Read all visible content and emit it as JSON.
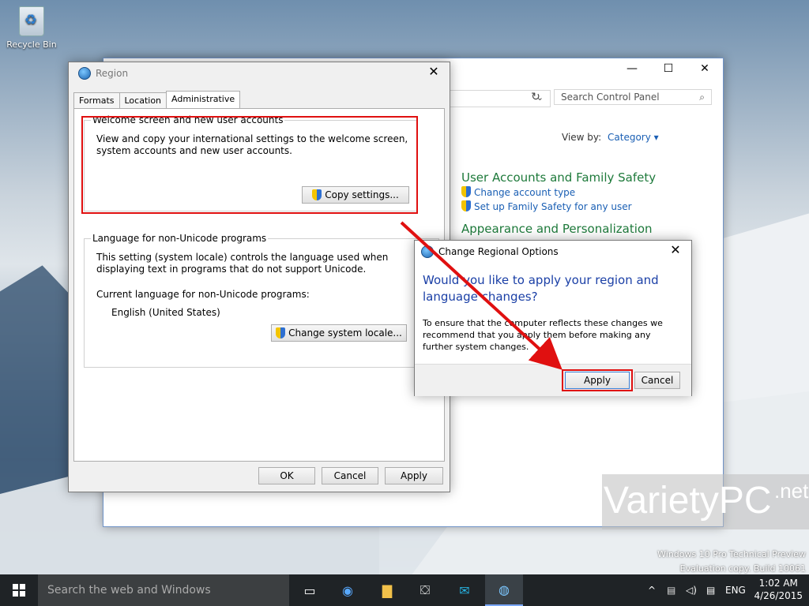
{
  "desktop": {
    "recycle_bin_label": "Recycle Bin",
    "watermark_brand": "VarietyPC",
    "watermark_suffix": ".net",
    "os_line1": "Windows 10 Pro Technical Preview",
    "os_line2": "Evaluation copy. Build 10061"
  },
  "control_panel": {
    "minimize": "—",
    "maximize": "☐",
    "close": "✕",
    "search_placeholder": "Search Control Panel",
    "view_by_label": "View by:",
    "view_by_value": "Category ▾",
    "section1_title": "User Accounts and Family Safety",
    "section1_link1": "Change account type",
    "section1_link2": "Set up Family Safety for any user",
    "section2_title": "Appearance and Personalization"
  },
  "region_dialog": {
    "title": "Region",
    "close": "✕",
    "tabs": [
      "Formats",
      "Location",
      "Administrative"
    ],
    "group1": {
      "legend": "Welcome screen and new user accounts",
      "text": "View and copy your international settings to the welcome screen, system accounts and new user accounts.",
      "button": "Copy settings..."
    },
    "group2": {
      "legend": "Language for non-Unicode programs",
      "text": "This setting (system locale) controls the language used when displaying text in programs that do not support Unicode.",
      "current_label": "Current language for non-Unicode programs:",
      "current_value": "English (United States)",
      "button": "Change system locale..."
    },
    "ok": "OK",
    "cancel": "Cancel",
    "apply": "Apply"
  },
  "confirm_dialog": {
    "title": "Change Regional Options",
    "close": "✕",
    "question": "Would you like to apply your region and language changes?",
    "message": "To ensure that the computer reflects these changes we recommend that you apply them before making any further system changes.",
    "apply": "Apply",
    "cancel": "Cancel"
  },
  "taskbar": {
    "search_placeholder": "Search the web and Windows",
    "language": "ENG",
    "time": "1:02 AM",
    "date": "4/26/2015"
  },
  "colors": {
    "highlight_red": "#e01010",
    "link_blue": "#1a5fb4",
    "heading_green": "#1e7a3b",
    "question_blue": "#1a3fa6"
  }
}
